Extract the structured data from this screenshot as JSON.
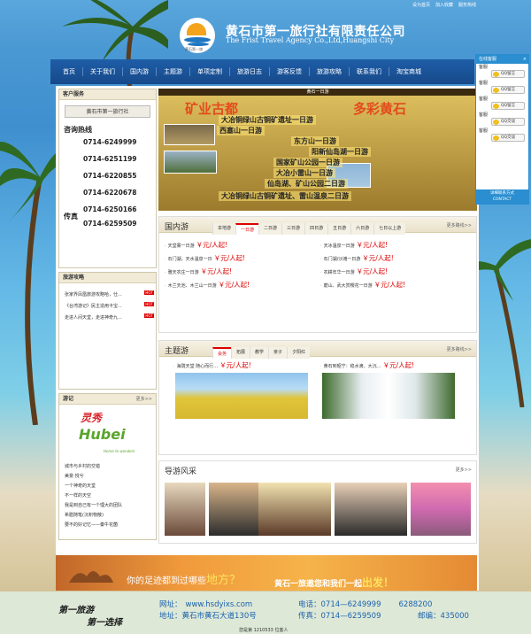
{
  "top_links": [
    "设为首页",
    "加入收藏",
    "服务热线"
  ],
  "header": {
    "title_cn": "黄石市第一旅行社有限责任公司",
    "title_en": "The Frist Travel Agency Co.,Ltd,Huangshi City",
    "logo_text": "黄石第一旅"
  },
  "nav": [
    "首页",
    "关于我们",
    "国内游",
    "主题游",
    "单项定制",
    "旅游日志",
    "游客反馈",
    "旅游攻略",
    "联系我们",
    "淘宝商城"
  ],
  "sidebar": {
    "service_title": "客户服务",
    "company_button": "黄石市第一旅行社",
    "hotline_label": "咨询热线",
    "phones": [
      "0714-6249999",
      "0714-6251199",
      "0714-6220855",
      "0714-6220678",
      "0714-6250166"
    ],
    "fax_label": "传真",
    "fax": "0714-6259509",
    "guide_title": "旅游攻略",
    "guide_items": [
      "张家界凤凰旅游攻略哈，仕...",
      "《台湾游记》民主造用卡宝...",
      "走进人间天堂，走进神奇九..."
    ],
    "guide_hot": "HOT",
    "travel_title": "游记",
    "travel_more": "更多>>",
    "hubei_logo": {
      "line1": "灵秀",
      "line2": "Hubei",
      "tagline": "Home to wonders"
    },
    "travel_items": [
      "城市与乡村的交错",
      "美景·悦兮",
      "一个神奇的天堂",
      "不一样的天空",
      "我是到自己有一个理大的团队",
      "希腊随笔(沉积物散)",
      "要不的好记忆——秦牛花菌"
    ]
  },
  "banner": {
    "top_text": "黄石一日游",
    "big_left": "矿业古都",
    "big_right": "多彩黄石",
    "lines": [
      "大冶铜绿山古铜矿遗址一日游",
      "西塞山一日游",
      "东方山一日游",
      "阳新仙岛湖一日游",
      "国家矿山公园一日游",
      "大冶小雷山一日游",
      "仙岛湖、矿山公园二日游",
      "大冶铜绿山古铜矿遗址、雷山温泉二日游"
    ]
  },
  "domestic": {
    "title": "国内游",
    "tabs": [
      "本地游",
      "一日游",
      "二日游",
      "三日游",
      "四日游",
      "五日游",
      "六日游",
      "七日以上游"
    ],
    "active_tab": 1,
    "more": "更多路线>>",
    "price_suffix": "￥元/人起!",
    "trips_left": [
      "天堂寨一日游",
      "石门湖，天水温泉一日",
      "雅天农庄一日游",
      "木兰天池、木兰山一日游"
    ],
    "trips_right": [
      "天冰温泉一日游",
      "石门湖/沙滩一日游",
      "农耕年华一日游",
      "磨山、武大赏樱花一日游"
    ]
  },
  "theme": {
    "title": "主题游",
    "tabs": [
      "会务",
      "拓展",
      "教学",
      "亲子",
      "夕阳红"
    ],
    "active_tab": 0,
    "more": "更多路线>>",
    "trips": [
      "海陇天堂 随心而行…",
      "黄石到昭宁：稳水滴、大沉…"
    ],
    "price_suffix": "￥元/人起!"
  },
  "guides": {
    "title": "导游风采",
    "more": "更多>>"
  },
  "footer_banner": {
    "text1": "你的足迹都到过哪些",
    "text1_em": "地方？",
    "text2": "黄石一旅邀您和我们一起",
    "text2_em": "出发！"
  },
  "footer": {
    "slogan1": "第一旅游",
    "slogan2": "第一选择",
    "web_label": "网址：",
    "web": "www.hsdyixs.com",
    "tel_label": "电话：",
    "tel1": "0714—6249999",
    "tel2": "6288200",
    "addr_label": "地址：",
    "addr": "黄石市黄石大道130号",
    "fax_label": "传真：",
    "fax": "0714—6259509",
    "zip_label": "邮编：",
    "zip": "435000",
    "visits": "您是第 1210533 位客人"
  },
  "online_service": {
    "title": "在线客服",
    "close": "×",
    "label": "客服",
    "qq_labels": [
      "QQ留言",
      "QQ留言",
      "QQ留言",
      "QQ交谈",
      "QQ交谈"
    ],
    "footer_cn": "详细联系方式",
    "footer_en": "CONTACT"
  },
  "colors": {
    "nav": "#1e5ea8",
    "price": "#dd0000",
    "link": "#1b62ad"
  }
}
